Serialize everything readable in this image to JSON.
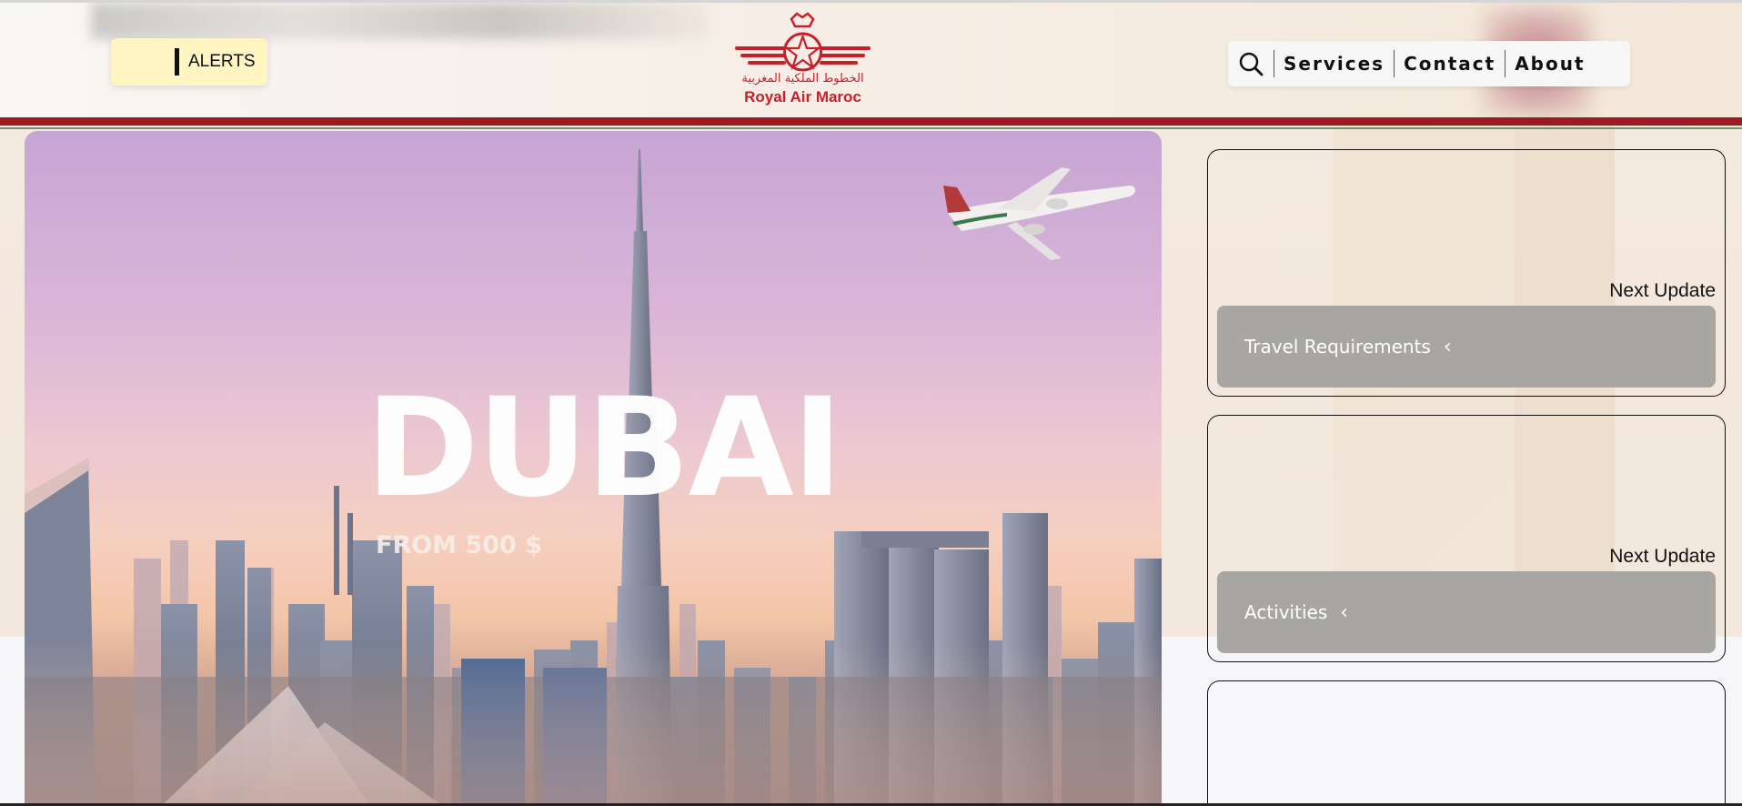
{
  "header": {
    "alerts_label": "ALERTS",
    "logo": {
      "arabic": "الخطوط الملكية المغربية",
      "brand": "Royal Air Maroc"
    },
    "nav": [
      {
        "label": "Services"
      },
      {
        "label": "Contact"
      },
      {
        "label": "About"
      }
    ],
    "search_icon": "search-icon"
  },
  "hero": {
    "title": "DUBAI",
    "price": "FROM 500 $"
  },
  "cards": [
    {
      "next_label": "Next Update",
      "button_label": "Travel Requirements",
      "icon": "chevron-left-icon"
    },
    {
      "next_label": "Next Update",
      "button_label": "Activities",
      "icon": "chevron-left-icon"
    }
  ],
  "colors": {
    "brand_red": "#c8202b",
    "rule_red": "#9c1b22",
    "alert_yellow": "#fff5c3",
    "button_gray": "#a8a6a3"
  }
}
